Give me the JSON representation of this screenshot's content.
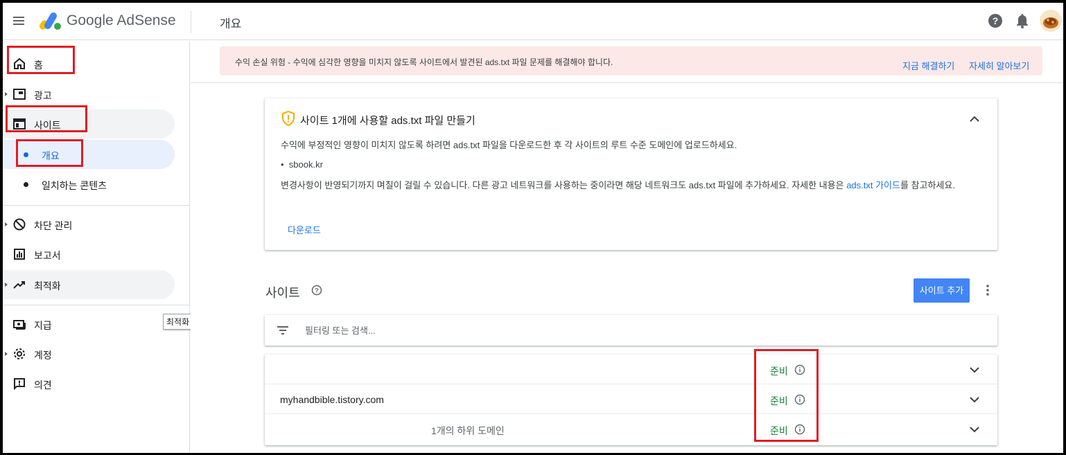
{
  "header": {
    "app_name": "Google AdSense",
    "page_title": "개요"
  },
  "sidebar": {
    "items": [
      {
        "label": "홈"
      },
      {
        "label": "광고"
      },
      {
        "label": "사이트"
      },
      {
        "label": "개요"
      },
      {
        "label": "일치하는 콘텐츠"
      },
      {
        "label": "차단 관리"
      },
      {
        "label": "보고서"
      },
      {
        "label": "최적화"
      },
      {
        "label": "지급"
      },
      {
        "label": "계정"
      },
      {
        "label": "의견"
      }
    ],
    "tooltip": "최적화"
  },
  "alert": {
    "text": "수익 손실 위험 - 수익에 심각한 영향을 미치지 않도록 사이트에서 발견된 ads.txt 파일 문제를 해결해야 합니다.",
    "fix_link": "지금 해결하기",
    "learn_link": "자세히 알아보기"
  },
  "card": {
    "title": "사이트 1개에 사용할 ads.txt 파일 만들기",
    "description": "수익에 부정적인 영향이 미치지 않도록 하려면 ads.txt 파일을 다운로드한 후 각 사이트의 루트 수준 도메인에 업로드하세요.",
    "site": "sbook.kr",
    "note_before": "변경사항이 반영되기까지 며칠이 걸릴 수 있습니다. 다른 광고 네트워크를 사용하는 중이라면 해당 네트워크도 ads.txt 파일에 추가하세요. 자세한 내용은 ",
    "note_link": "ads.txt 가이드",
    "note_after": "를 참고하세요.",
    "download": "다운로드"
  },
  "sites": {
    "title": "사이트",
    "add_button": "사이트 추가",
    "filter_placeholder": "필터링 또는 검색...",
    "rows": [
      {
        "name": "",
        "sub": "",
        "status": "준비"
      },
      {
        "name": "myhandbible.tistory.com",
        "sub": "",
        "status": "준비"
      },
      {
        "name": "",
        "sub": "1개의 하위 도메인",
        "status": "준비"
      }
    ]
  },
  "colors": {
    "accent": "#1a73e8",
    "button": "#4285f4",
    "status_ready": "#188038",
    "alert_bg": "#fce8e6",
    "annotation": "#e31b23"
  }
}
